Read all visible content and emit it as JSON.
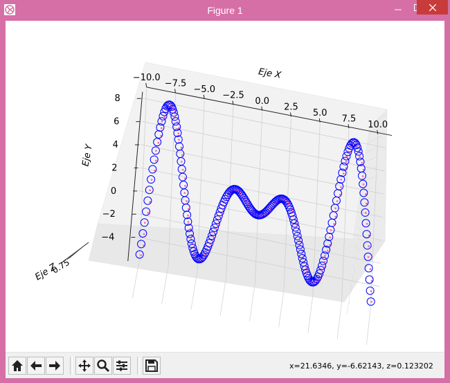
{
  "window": {
    "title": "Figure 1",
    "minimize_icon": "minimize-icon",
    "maximize_icon": "maximize-icon",
    "close_icon": "close-icon"
  },
  "colors": {
    "titlebar": "#d66fa6",
    "close_button": "#c83b3b",
    "marker_edge": "#0000ff",
    "inner_point": "#ff69b4"
  },
  "toolbar": {
    "buttons": [
      {
        "name": "home-button",
        "icon": "home-icon"
      },
      {
        "name": "back-button",
        "icon": "arrow-left-icon"
      },
      {
        "name": "forward-button",
        "icon": "arrow-right-icon"
      },
      {
        "name": "pan-button",
        "icon": "move-icon"
      },
      {
        "name": "zoom-button",
        "icon": "magnifier-icon"
      },
      {
        "name": "subplots-button",
        "icon": "sliders-icon"
      },
      {
        "name": "save-button",
        "icon": "floppy-disk-icon"
      }
    ],
    "coords": {
      "x": "x=21.6346",
      "y": ", y=-6.62143",
      "z": ", z=0.123202"
    }
  },
  "chart_data": {
    "type": "scatter3d",
    "xlabel": "Eje X",
    "ylabel": "Eje Y",
    "zlabel": "Eje Z",
    "x_ticks": [
      "−10.0",
      "−7.5",
      "−5.0",
      "−2.5",
      "0.0",
      "2.5",
      "5.0",
      "7.5",
      "10.0"
    ],
    "y_ticks": [
      "8",
      "6",
      "4",
      "2",
      "0",
      "−2",
      "−4"
    ],
    "z_ticks_visible": [
      "0.75"
    ],
    "xlim": [
      -10,
      10
    ],
    "ylim": [
      -5,
      9
    ],
    "grid": true,
    "series": [
      {
        "marker": "circle-open",
        "curve": "y = x * sin(x)",
        "x_range": [
          -10,
          10
        ],
        "points": 200
      },
      {
        "marker": "small-pink-dot",
        "curve": "y = x * sin(x)",
        "x_range": [
          -10,
          10
        ],
        "points": 200
      }
    ]
  }
}
